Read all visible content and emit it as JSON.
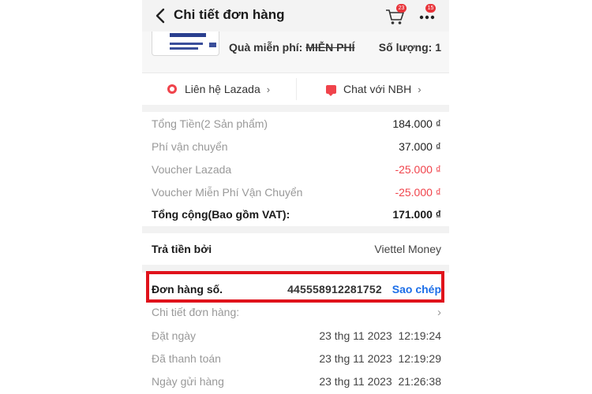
{
  "header": {
    "title": "Chi tiết đơn hàng",
    "cart_badge": "23",
    "more_badge": "15"
  },
  "product": {
    "gift_label": "Quà miễn phí:",
    "gift_value": "MIỄN PHÍ",
    "quantity": "Số lượng: 1"
  },
  "contact": {
    "lazada": "Liên hệ Lazada",
    "chat": "Chat với NBH"
  },
  "summary": {
    "rows": [
      {
        "label": "Tổng Tiền(2 Sản phẩm)",
        "value": "184.000 ₫"
      },
      {
        "label": "Phí vận chuyển",
        "value": "37.000 ₫"
      },
      {
        "label": "Voucher Lazada",
        "value": "-25.000 ₫"
      },
      {
        "label": "Voucher Miễn Phí Vận Chuyển",
        "value": "-25.000 ₫"
      },
      {
        "label": "Tổng cộng(Bao gồm VAT):",
        "value": "171.000 ₫"
      }
    ]
  },
  "payment": {
    "label": "Trả tiền bởi",
    "value": "Viettel Money"
  },
  "order": {
    "number_label": "Đơn hàng số.",
    "number_value": "445558912281752",
    "copy_label": "Sao chép",
    "details_label": "Chi tiết đơn hàng:",
    "dates": [
      {
        "label": "Đặt ngày",
        "date": "23 thg 11 2023",
        "time": "12:19:24"
      },
      {
        "label": "Đã thanh toán",
        "date": "23 thg 11 2023",
        "time": "12:19:29"
      },
      {
        "label": "Ngày gửi hàng",
        "date": "23 thg 11 2023",
        "time": "21:26:38"
      }
    ]
  },
  "colors": {
    "accent_red": "#f0434b",
    "link_blue": "#1d6fe8",
    "highlight_red": "#e0121b"
  }
}
